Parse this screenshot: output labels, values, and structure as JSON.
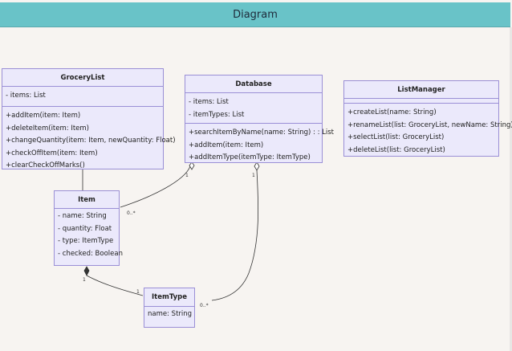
{
  "header": {
    "title": "Diagram"
  },
  "classes": {
    "grocery_list": {
      "name": "GroceryList",
      "attributes": [
        "- items: List"
      ],
      "methods": [
        "+addItem(item: Item)",
        "+deleteItem(item: Item)",
        "+changeQuantity(item: Item, newQuantity: Float)",
        "+checkOffItem(item: Item)",
        "+clearCheckOffMarks()"
      ]
    },
    "database": {
      "name": "Database",
      "attributes": [
        "- items: List",
        "- itemTypes: List"
      ],
      "methods": [
        "+searchItemByName(name: String) : : List",
        "+addItem(item: Item)",
        "+addItemType(itemType: ItemType)"
      ]
    },
    "list_manager": {
      "name": "ListManager",
      "attributes": [],
      "methods": [
        "+createList(name: String)",
        "+renameList(list: GroceryList, newName: String)",
        "+selectList(list: GroceryList)",
        "+deleteList(list: GroceryList)"
      ]
    },
    "item": {
      "name": "Item",
      "attributes": [
        "- name: String",
        "- quantity: Float",
        "- type: ItemType",
        "- checked: Boolean"
      ],
      "methods": []
    },
    "item_type": {
      "name": "ItemType",
      "attributes": [
        "name: String"
      ],
      "methods": []
    }
  },
  "multiplicities": {
    "db_items_source": "1",
    "db_items_target": "0..*",
    "db_types_source": "1",
    "db_types_target": "0..*",
    "item_composition_source": "1",
    "item_composition_target": "1"
  },
  "colors": {
    "header_bg": "#69c3c8",
    "class_fill": "#ebe9fb",
    "class_border": "#9a8fd6",
    "background": "#f7f4f1"
  }
}
